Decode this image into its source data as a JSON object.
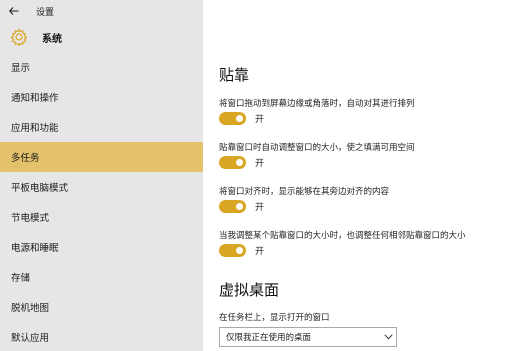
{
  "window": {
    "title": "设置"
  },
  "header": {
    "section_title": "系统"
  },
  "sidebar": {
    "items": [
      {
        "label": "显示"
      },
      {
        "label": "通知和操作"
      },
      {
        "label": "应用和功能"
      },
      {
        "label": "多任务"
      },
      {
        "label": "平板电脑模式"
      },
      {
        "label": "节电模式"
      },
      {
        "label": "电源和睡眠"
      },
      {
        "label": "存储"
      },
      {
        "label": "脱机地图"
      },
      {
        "label": "默认应用"
      }
    ],
    "active_item": "多任务"
  },
  "snap": {
    "heading": "贴靠",
    "settings": [
      {
        "label": "将窗口拖动到屏幕边缘或角落时，自动对其进行排列",
        "state": "开",
        "on": true
      },
      {
        "label": "贴靠窗口时自动调整窗口的大小，使之填满可用空间",
        "state": "开",
        "on": true
      },
      {
        "label": "将窗口对齐时，显示能够在其旁边对齐的内容",
        "state": "开",
        "on": true
      },
      {
        "label": "当我调整某个贴靠窗口的大小时，也调整任何相邻贴靠窗口的大小",
        "state": "开",
        "on": true
      }
    ]
  },
  "virtual_desktop": {
    "heading": "虚拟桌面",
    "taskbar_label": "在任务栏上，显示打开的窗口",
    "taskbar_value": "仅限我正在使用的桌面"
  },
  "colors": {
    "accent": "#d9a723",
    "nav_active": "#e4c26c",
    "sidebar_bg": "#e6e6e6"
  },
  "icons": {
    "back": "back-arrow-icon",
    "gear": "gear-icon",
    "dropdown": "chevron-down-icon"
  }
}
